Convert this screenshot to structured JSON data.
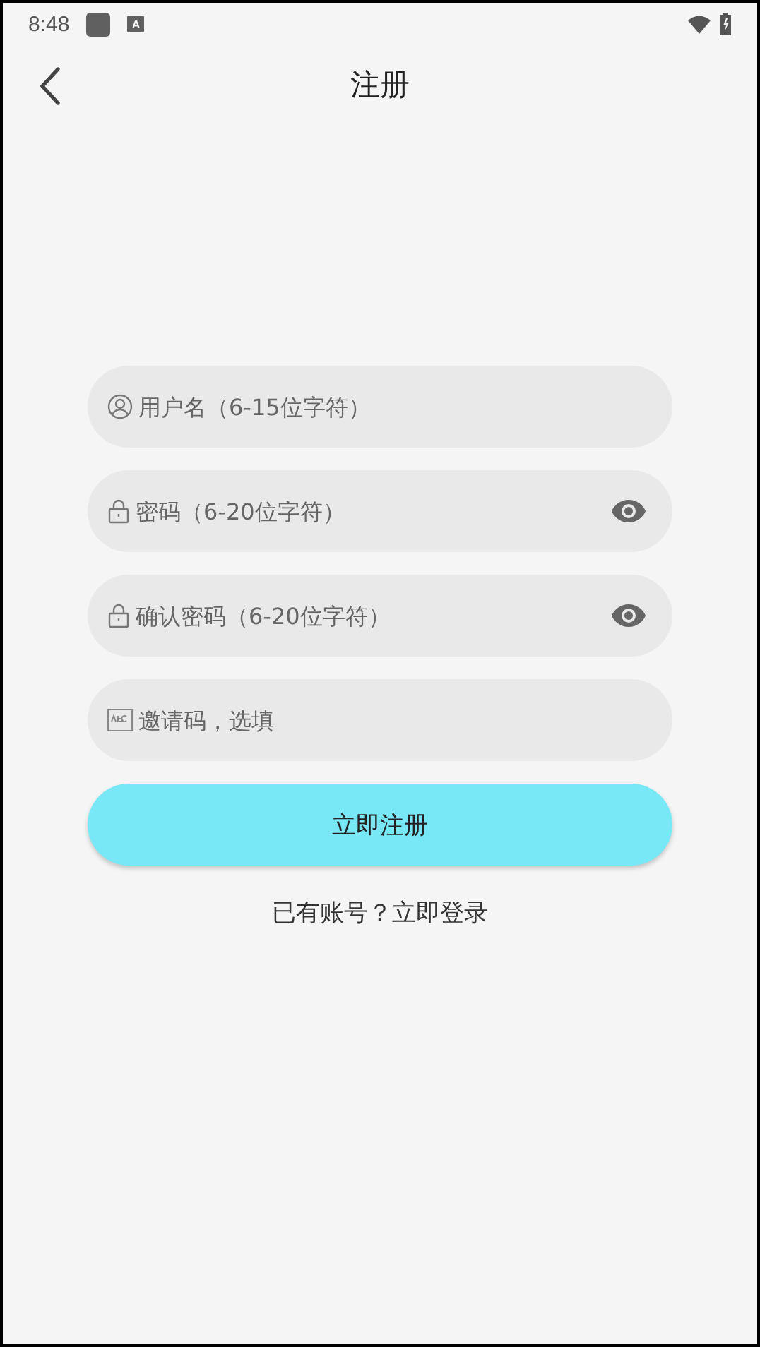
{
  "status_bar": {
    "time": "8:48",
    "notification_letter": "A"
  },
  "header": {
    "title": "注册"
  },
  "fields": [
    {
      "kind": "user",
      "placeholder": "用户名（6-15位字符）",
      "reveal_toggle": false
    },
    {
      "kind": "lock",
      "placeholder": "密码（6-20位字符）",
      "reveal_toggle": true
    },
    {
      "kind": "lock",
      "placeholder": "确认密码（6-20位字符）",
      "reveal_toggle": true
    },
    {
      "kind": "code",
      "placeholder": "邀请码，选填",
      "reveal_toggle": false
    }
  ],
  "submit_button": "立即注册",
  "login_link": "已有账号？立即登录"
}
